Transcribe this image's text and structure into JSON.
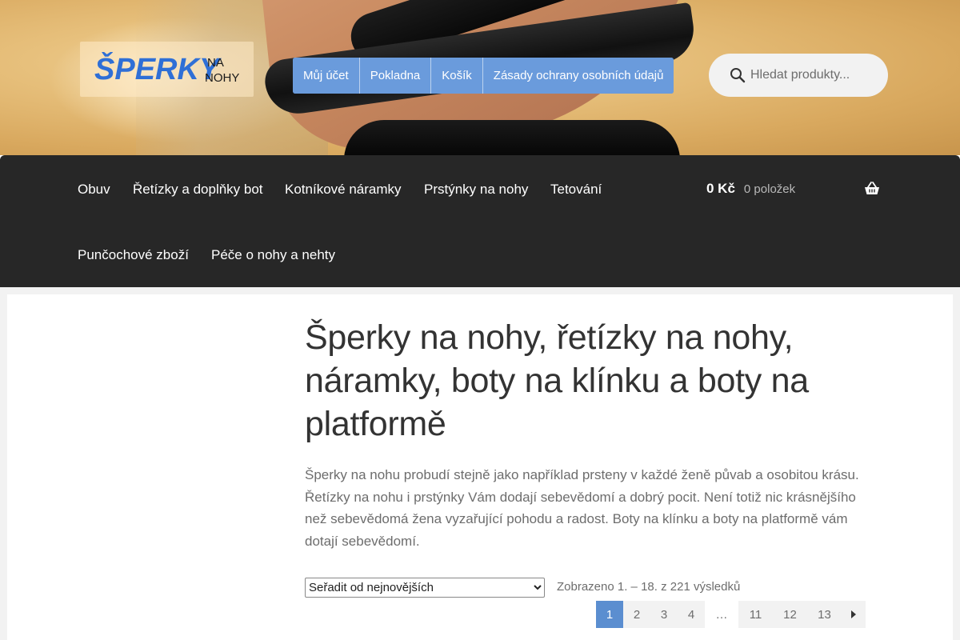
{
  "header": {
    "logo": {
      "main": "ŠPERKY",
      "small_top": "NA",
      "small_bottom": "NOHY"
    },
    "topnav": [
      "Můj účet",
      "Pokladna",
      "Košík",
      "Zásady ochrany osobních údajů"
    ],
    "search": {
      "placeholder": "Hledat produkty...",
      "value": ""
    }
  },
  "mainnav": {
    "items": [
      "Obuv",
      "Řetízky a doplňky bot",
      "Kotníkové náramky",
      "Prstýnky na nohy",
      "Tetování",
      "Punčochové zboží",
      "Péče o nohy a nehty"
    ],
    "cart": {
      "amount": "0 Kč",
      "count": "0 položek",
      "icon": "basket-icon"
    }
  },
  "main": {
    "title": "Šperky na nohy, řetízky na nohy, náramky, boty na klínku a boty na platformě",
    "description": "Šperky na nohu probudí stejně jako například prsteny v každé ženě půvab a osobitou krásu. Řetízky na nohu i prstýnky Vám dodají sebevědomí a dobrý pocit. Není totiž nic krásnějšího než sebevědomá žena vyzařující pohodu a radost. Boty na klínku a boty na platformě vám dotají sebevědomí.",
    "sort": {
      "selected": "Seřadit od nejnovějších"
    },
    "results": "Zobrazeno 1. – 18. z 221 výsledků",
    "pagination": {
      "pages": [
        "1",
        "2",
        "3",
        "4",
        "…",
        "11",
        "12",
        "13"
      ],
      "current": "1",
      "next_icon": "caret-right-icon"
    }
  },
  "colors": {
    "accent": "#5b8ed0",
    "nav_bg": "#272727",
    "title": "#333333",
    "text": "#6d6d6d",
    "logo_blue": "#2f6fd6"
  }
}
